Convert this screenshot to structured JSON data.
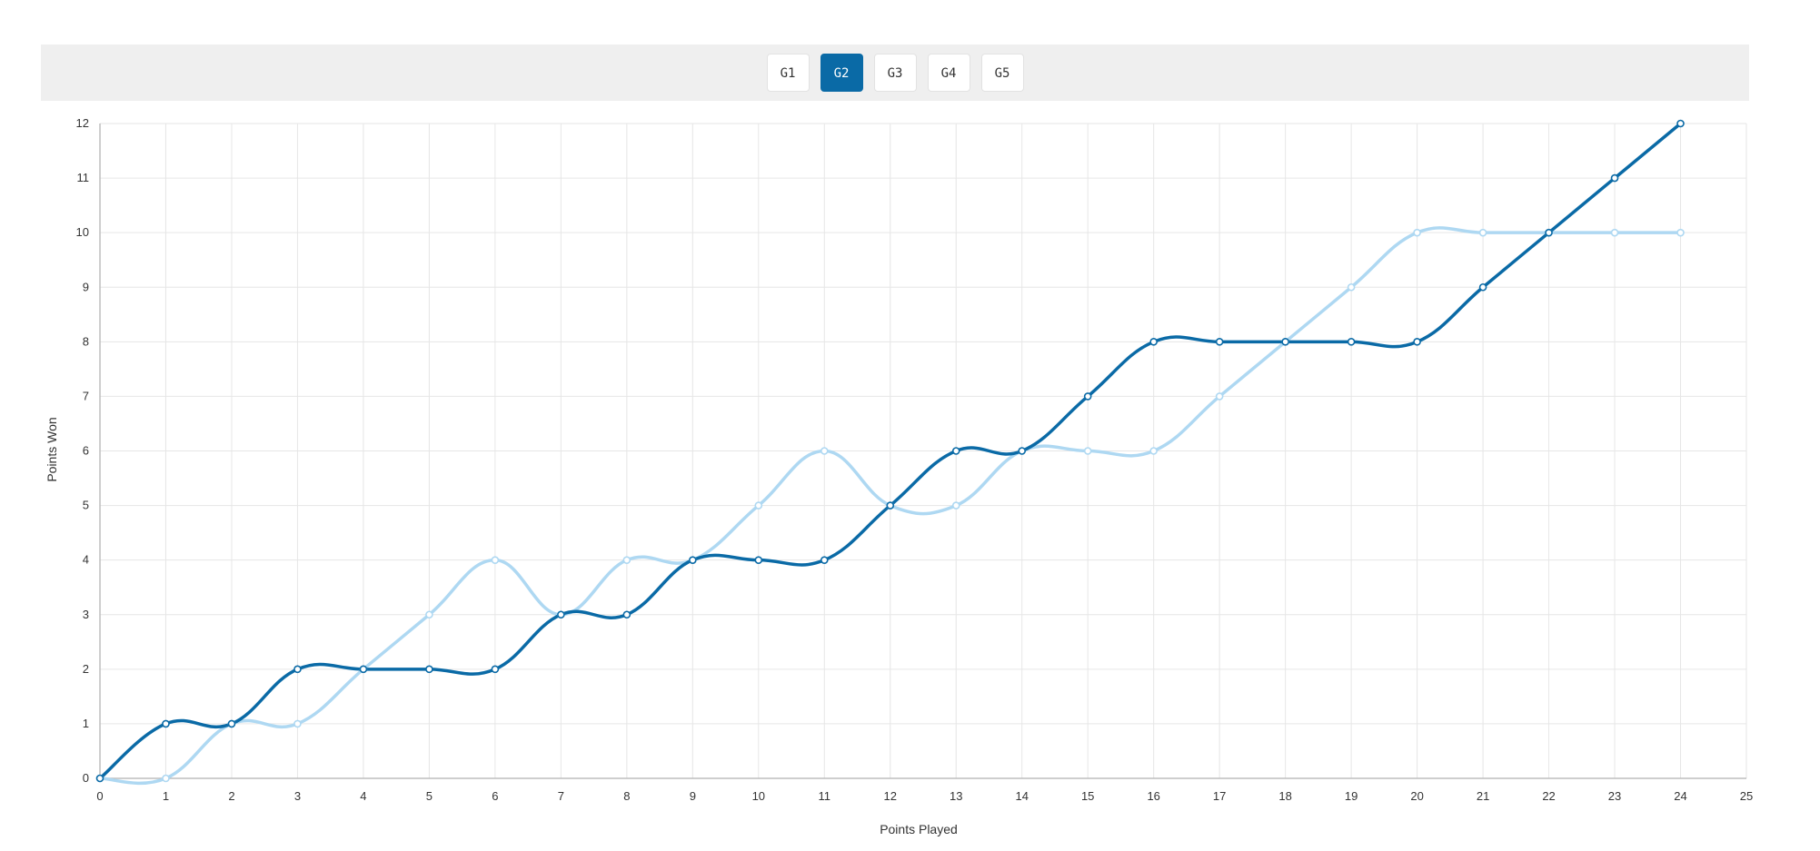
{
  "tabs": [
    {
      "label": "G1",
      "active": false
    },
    {
      "label": "G2",
      "active": true
    },
    {
      "label": "G3",
      "active": false
    },
    {
      "label": "G4",
      "active": false
    },
    {
      "label": "G5",
      "active": false
    }
  ],
  "colors": {
    "accent": "#0a6aa6",
    "series_dark": "#0a6aa6",
    "series_light": "#aed8f2",
    "grid": "#e6e6e6",
    "tab_bar": "#efefef"
  },
  "chart_data": {
    "type": "line",
    "xlabel": "Points Played",
    "ylabel": "Points Won",
    "xlim": [
      0,
      25
    ],
    "ylim": [
      0,
      12
    ],
    "xticks": [
      0,
      1,
      2,
      3,
      4,
      5,
      6,
      7,
      8,
      9,
      10,
      11,
      12,
      13,
      14,
      15,
      16,
      17,
      18,
      19,
      20,
      21,
      22,
      23,
      24,
      25
    ],
    "yticks": [
      0,
      1,
      2,
      3,
      4,
      5,
      6,
      7,
      8,
      9,
      10,
      11,
      12
    ],
    "grid": true,
    "smooth": true,
    "x": [
      0,
      1,
      2,
      3,
      4,
      5,
      6,
      7,
      8,
      9,
      10,
      11,
      12,
      13,
      14,
      15,
      16,
      17,
      18,
      19,
      20,
      21,
      22,
      23,
      24
    ],
    "series": [
      {
        "color": "#aed8f2",
        "values": [
          0,
          0,
          1,
          1,
          2,
          3,
          4,
          3,
          4,
          4,
          5,
          6,
          5,
          5,
          6,
          6,
          6,
          7,
          8,
          9,
          10,
          10,
          10,
          10,
          10
        ]
      },
      {
        "color": "#0a6aa6",
        "values": [
          0,
          1,
          1,
          2,
          2,
          2,
          2,
          3,
          3,
          4,
          4,
          4,
          5,
          6,
          6,
          7,
          8,
          8,
          8,
          8,
          8,
          9,
          10,
          11,
          12
        ]
      }
    ]
  }
}
